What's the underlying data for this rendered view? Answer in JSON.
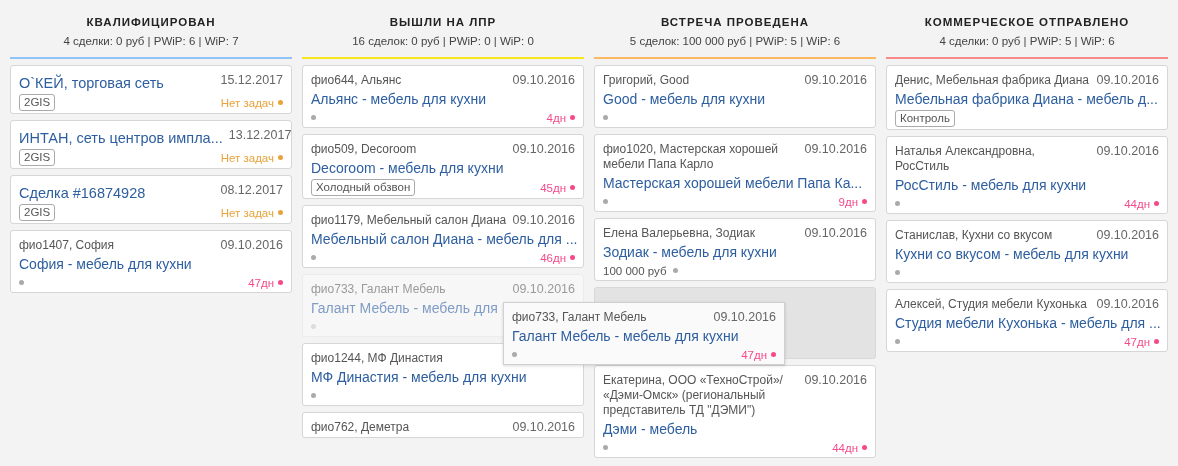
{
  "columns": [
    {
      "title": "КВАЛИФИЦИРОВАН",
      "summary": "4 сделки: 0 руб | PWiP: 6 | WiP: 7",
      "color": "#90c4f8",
      "cards": [
        {
          "kind": "company",
          "title": "О`КЕЙ, торговая сеть",
          "date": "15.12.2017",
          "tag": "2GIS",
          "status": "Нет задач"
        },
        {
          "kind": "company",
          "title": "ИНТАН, сеть центров импла...",
          "date": "13.12.2017",
          "tag": "2GIS",
          "status": "Нет задач"
        },
        {
          "kind": "company",
          "title": "Сделка #16874928",
          "date": "08.12.2017",
          "tag": "2GIS",
          "status": "Нет задач"
        },
        {
          "kind": "contact",
          "contact": "фио1407, София",
          "date": "09.10.2016",
          "title": "София - мебель для кухни",
          "days": "47дн"
        }
      ]
    },
    {
      "title": "ВЫШЛИ НА ЛПР",
      "summary": "16 сделок: 0 руб | PWiP: 0 | WiP: 0",
      "color": "#f9e51c",
      "cards": [
        {
          "kind": "contact",
          "contact": "фио644, Альянс",
          "date": "09.10.2016",
          "title": "Альянс - мебель для кухни",
          "days": "4дн"
        },
        {
          "kind": "contact",
          "contact": "фио509, Decoroom",
          "date": "09.10.2016",
          "title": "Decoroom - мебель для кухни",
          "tag": "Холодный обзвон",
          "days": "45дн"
        },
        {
          "kind": "contact",
          "contact": "фио1179, Мебельный салон Диана",
          "date": "09.10.2016",
          "title": "Мебельный салон Диана - мебель для ...",
          "days": "46дн"
        },
        {
          "kind": "faded",
          "contact": "фио733, Галант Мебель",
          "date": "09.10.2016",
          "title": "Галант Мебель - мебель для"
        },
        {
          "kind": "contact",
          "contact": "фио1244, МФ Династия",
          "title": "МФ Династия - мебель для кухни"
        },
        {
          "kind": "contact",
          "contact": "фио762, Деметра",
          "date": "09.10.2016"
        }
      ]
    },
    {
      "title": "ВСТРЕЧА ПРОВЕДЕНА",
      "summary": "5 сделок: 100 000 руб | PWiP: 5 | WiP: 6",
      "color": "#fdb862",
      "cards": [
        {
          "kind": "contact",
          "contact": "Григорий, Good",
          "date": "09.10.2016",
          "title": "Good - мебель для кухни"
        },
        {
          "kind": "contact",
          "contact": "фио1020, Мастерская хорошей мебели Папа Карло",
          "date": "09.10.2016",
          "title": "Мастерская хорошей мебели Папа Ка...",
          "days": "9дн"
        },
        {
          "kind": "contact",
          "contact": "Елена Валерьевна, Зодиак",
          "date": "09.10.2016",
          "title": "Зодиак - мебель для кухни",
          "amount": "100 000 руб"
        },
        {
          "kind": "placeholder"
        },
        {
          "kind": "contact",
          "contact": "Екатерина, ООО «ТехноСтрой»/ «Дэми-Омск» (региональный представитель ТД \"ДЭМИ\")",
          "date": "09.10.2016",
          "title": "Дэми - мебель",
          "days": "44дн"
        }
      ]
    },
    {
      "title": "КОММЕРЧЕСКОЕ ОТПРАВЛЕНО",
      "summary": "4 сделки: 0 руб | PWiP: 5 | WiP: 6",
      "color": "#f98a8a",
      "cards": [
        {
          "kind": "contact",
          "contact": "Денис, Мебельная фабрика Диана",
          "date": "09.10.2016",
          "title": "Мебельная фабрика Диана - мебель д...",
          "tag": "Контроль"
        },
        {
          "kind": "contact",
          "contact": "Наталья Александровна, РосСтиль",
          "date": "09.10.2016",
          "title": "РосСтиль - мебель для кухни",
          "days": "44дн"
        },
        {
          "kind": "contact",
          "contact": "Станислав, Кухни со вкусом",
          "date": "09.10.2016",
          "title": "Кухни со вкусом - мебель для кухни"
        },
        {
          "kind": "contact",
          "contact": "Алексей, Студия мебели Кухонька",
          "date": "09.10.2016",
          "title": "Студия мебели Кухонька - мебель для ...",
          "days": "47дн"
        }
      ]
    }
  ],
  "drag_card": {
    "contact": "фио733, Галант Мебель",
    "date": "09.10.2016",
    "title": "Галант Мебель - мебель для кухни",
    "days": "47дн"
  }
}
